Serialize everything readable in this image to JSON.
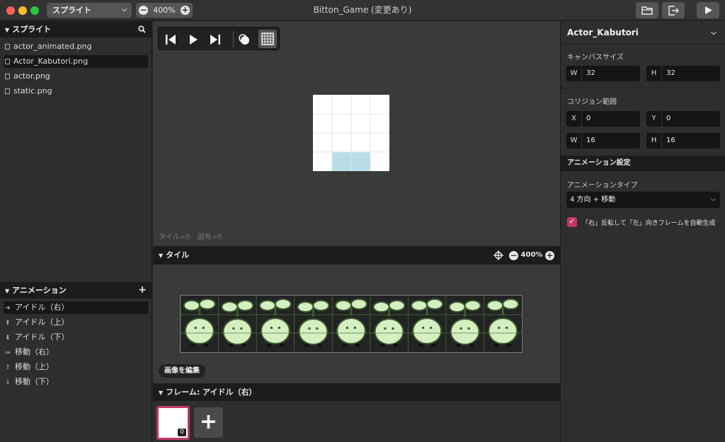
{
  "window": {
    "title": "Bitton_Game (変更あり)"
  },
  "toolbar": {
    "sprite_select": "スプライト",
    "zoom": "400%"
  },
  "sprites_panel": {
    "title": "スプライト",
    "items": [
      {
        "label": "actor_animated.png",
        "selected": false
      },
      {
        "label": "Actor_Kabutori.png",
        "selected": true
      },
      {
        "label": "actor.png",
        "selected": false
      },
      {
        "label": "static.png",
        "selected": false
      }
    ]
  },
  "animations_panel": {
    "title": "アニメーション",
    "items": [
      {
        "label": "アイドル（右）",
        "icon": "arrow-right-icon",
        "selected": true
      },
      {
        "label": "アイドル（上）",
        "icon": "arrow-up-icon",
        "selected": false
      },
      {
        "label": "アイドル（下）",
        "icon": "arrow-down-icon",
        "selected": false
      },
      {
        "label": "移動（右）",
        "icon": "double-arrow-right-icon",
        "selected": false
      },
      {
        "label": "移動（上）",
        "icon": "double-arrow-up-icon",
        "selected": false
      },
      {
        "label": "移動（下）",
        "icon": "double-arrow-down-icon",
        "selected": false
      }
    ]
  },
  "canvas": {
    "info": "タイル=0　固有=0"
  },
  "tiles": {
    "title": "タイル",
    "zoom": "400%",
    "edit_button": "画像を編集",
    "frame_count": 9
  },
  "frames": {
    "title": "フレーム: アイドル（右）",
    "frame_number": "0"
  },
  "inspector": {
    "title": "Actor_Kabutori",
    "canvas_size_label": "キャンバスサイズ",
    "canvas_w_label": "W",
    "canvas_w": "32",
    "canvas_h_label": "H",
    "canvas_h": "32",
    "collision_label": "コリジョン範囲",
    "col_x_label": "X",
    "col_x": "0",
    "col_y_label": "Y",
    "col_y": "0",
    "col_w_label": "W",
    "col_w": "16",
    "col_h_label": "H",
    "col_h": "16",
    "anim_settings_title": "アニメーション設定",
    "anim_type_label": "アニメーションタイプ",
    "anim_type_value": "4 方向 + 移動",
    "flip_checkbox_label": "「右」反転して「左」向きフレームを自動生成",
    "flip_checked": true
  },
  "colors": {
    "accent": "#c33868",
    "collision_highlight": "#b8dde6",
    "sprite_light": "#d4f0c0",
    "sprite_dark": "#3a5a30"
  }
}
